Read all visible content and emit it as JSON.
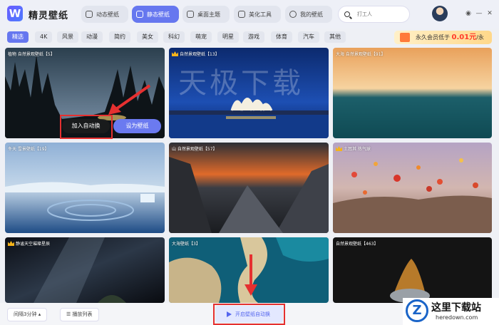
{
  "app": {
    "logo_letter": "W",
    "title": "精灵壁纸"
  },
  "nav": [
    {
      "label": "动态壁纸"
    },
    {
      "label": "静态壁纸"
    },
    {
      "label": "桌面主题"
    },
    {
      "label": "美化工具"
    },
    {
      "label": "我的壁纸"
    }
  ],
  "search": {
    "placeholder": "打工人"
  },
  "categories": [
    "精选",
    "4K",
    "风景",
    "动漫",
    "简约",
    "美女",
    "科幻",
    "萌宠",
    "明星",
    "游戏",
    "体育",
    "汽车",
    "其他"
  ],
  "vip_banner": {
    "text": "永久会员低于",
    "price": "0.01元",
    "suffix": "/永"
  },
  "cards": [
    {
      "title": "植物 自然景观壁纸【5】",
      "crown": false
    },
    {
      "title": "自然景观壁纸【13】",
      "crown": true
    },
    {
      "title": "大海 自然景观壁纸【91】",
      "crown": false
    },
    {
      "title": "冬天 雪景壁纸【19】",
      "crown": false
    },
    {
      "title": "山 自然景观壁纸【57】",
      "crown": false
    },
    {
      "title": "土耳其 热气球",
      "crown": true
    },
    {
      "title": "静谧天空璀璨星辰",
      "crown": true
    },
    {
      "title": "大海壁纸【3】",
      "crown": false
    },
    {
      "title": "自然景观壁纸【463】",
      "crown": false
    }
  ],
  "hover_buttons": {
    "add_auto": "加入自动换",
    "set_wallpaper": "设为壁纸"
  },
  "watermark": "天极下载",
  "bottom": {
    "interval": "间隔3分钟",
    "playlist": "播放列表",
    "start_auto": "开启壁纸自动换"
  },
  "brand": {
    "logo": "Z",
    "name": "这里下载站",
    "url": "heredown.com"
  },
  "colors": {
    "accent": "#6677ef",
    "highlight": "#e53030",
    "price": "#ff3a2a"
  }
}
